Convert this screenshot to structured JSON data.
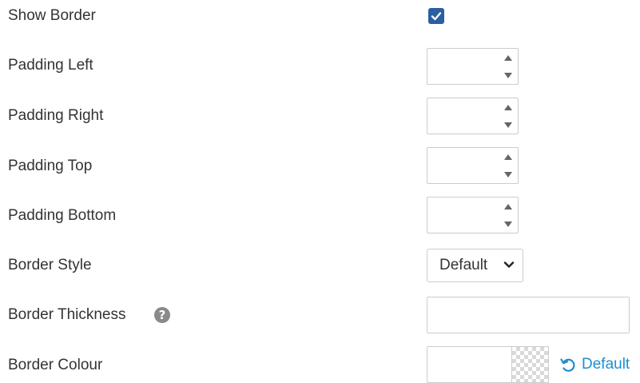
{
  "fields": {
    "show_border": {
      "label": "Show Border",
      "checked": true
    },
    "padding_left": {
      "label": "Padding Left",
      "value": ""
    },
    "padding_right": {
      "label": "Padding Right",
      "value": ""
    },
    "padding_top": {
      "label": "Padding Top",
      "value": ""
    },
    "padding_bottom": {
      "label": "Padding Bottom",
      "value": ""
    },
    "border_style": {
      "label": "Border Style",
      "selected": "Default"
    },
    "border_thickness": {
      "label": "Border Thickness",
      "help_icon": "question-circle-icon",
      "value": ""
    },
    "border_colour": {
      "label": "Border Colour",
      "value": "",
      "default_label": "Default",
      "default_icon": "undo-icon"
    }
  },
  "colors": {
    "checkbox": "#2a5fa0",
    "link": "#1b8fd0",
    "label_text": "#333333",
    "border": "#cccccc"
  }
}
